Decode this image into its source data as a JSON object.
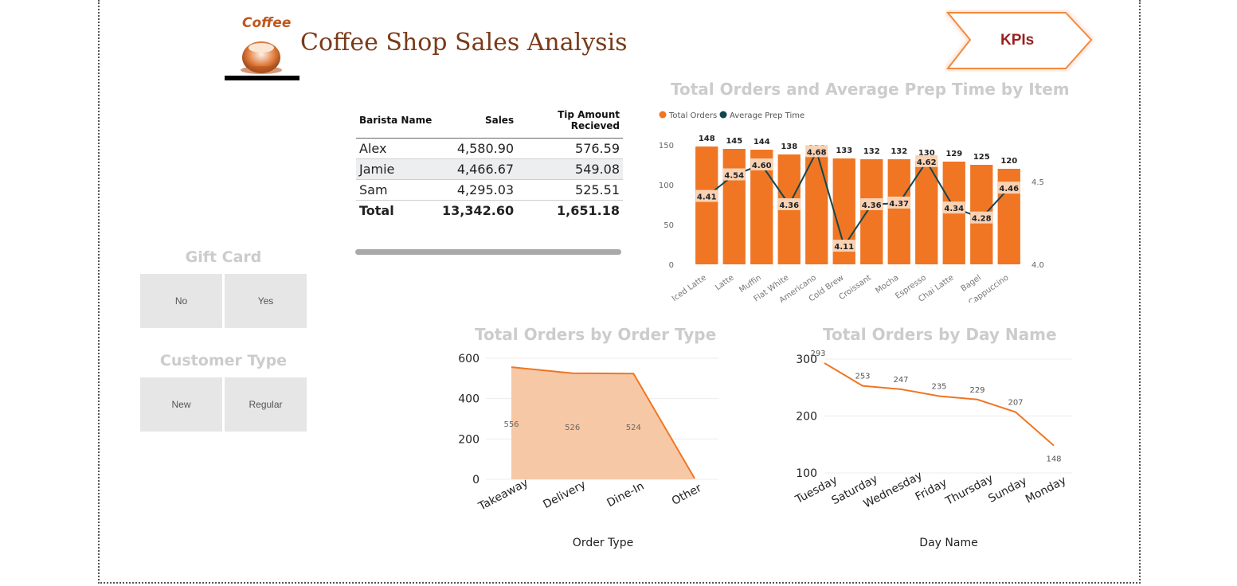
{
  "header": {
    "title": "Coffee Shop Sales Analysis",
    "logo_text": "Coffee",
    "kpi_button": "KPIs"
  },
  "colors": {
    "accent": "#f07623",
    "dark_line": "#12464f",
    "title_brown": "#7a3a18",
    "kpi_red": "#9a1f1f"
  },
  "barista_table": {
    "columns": [
      "Barista Name",
      "Sales",
      "Tip Amount Recieved"
    ],
    "rows": [
      [
        "Alex",
        "4,580.90",
        "576.59"
      ],
      [
        "Jamie",
        "4,466.67",
        "549.08"
      ],
      [
        "Sam",
        "4,295.03",
        "525.51"
      ]
    ],
    "total": [
      "Total",
      "13,342.60",
      "1,651.18"
    ]
  },
  "slicers": {
    "gift_card": {
      "title": "Gift Card",
      "options": [
        "No",
        "Yes"
      ]
    },
    "customer_type": {
      "title": "Customer Type",
      "options": [
        "New",
        "Regular"
      ]
    }
  },
  "chart_data": [
    {
      "type": "bar",
      "title": "Total Orders and Average Prep Time by Item",
      "legend": [
        "Total Orders",
        "Average Prep Time"
      ],
      "legend_position": "top-left",
      "categories": [
        "Iced Latte",
        "Latte",
        "Muffin",
        "Flat White",
        "Americano",
        "Cold Brew",
        "Croissant",
        "Mocha",
        "Espresso",
        "Chai Latte",
        "Bagel",
        "Cappuccino"
      ],
      "series": [
        {
          "name": "Total Orders",
          "values": [
            148,
            145,
            144,
            138,
            136,
            133,
            132,
            132,
            130,
            129,
            125,
            120
          ]
        },
        {
          "name": "Average Prep Time",
          "values": [
            4.41,
            4.54,
            4.6,
            4.36,
            4.68,
            4.11,
            4.36,
            4.37,
            4.62,
            4.34,
            4.28,
            4.46
          ]
        }
      ],
      "y_ticks": [
        "0",
        "50",
        "100",
        "150"
      ],
      "y2_ticks": [
        "4.0",
        "4.5"
      ],
      "ylim": [
        0,
        150
      ],
      "y2lim": [
        4.0,
        4.72
      ]
    },
    {
      "type": "area",
      "title": "Total Orders by Order Type",
      "xlabel": "Order Type",
      "categories": [
        "Takeaway",
        "Delivery",
        "Dine-In",
        "Other"
      ],
      "values": [
        556,
        526,
        524,
        5
      ],
      "data_labels": [
        "556",
        "526",
        "524"
      ],
      "y_ticks": [
        "0",
        "200",
        "400",
        "600"
      ],
      "ylim": [
        0,
        600
      ]
    },
    {
      "type": "line",
      "title": "Total Orders by Day Name",
      "xlabel": "Day Name",
      "categories": [
        "Tuesday",
        "Saturday",
        "Wednesday",
        "Friday",
        "Thursday",
        "Sunday",
        "Monday"
      ],
      "values": [
        293,
        253,
        247,
        235,
        229,
        207,
        148
      ],
      "y_ticks": [
        "100",
        "200",
        "300"
      ],
      "ylim": [
        100,
        300
      ]
    }
  ]
}
